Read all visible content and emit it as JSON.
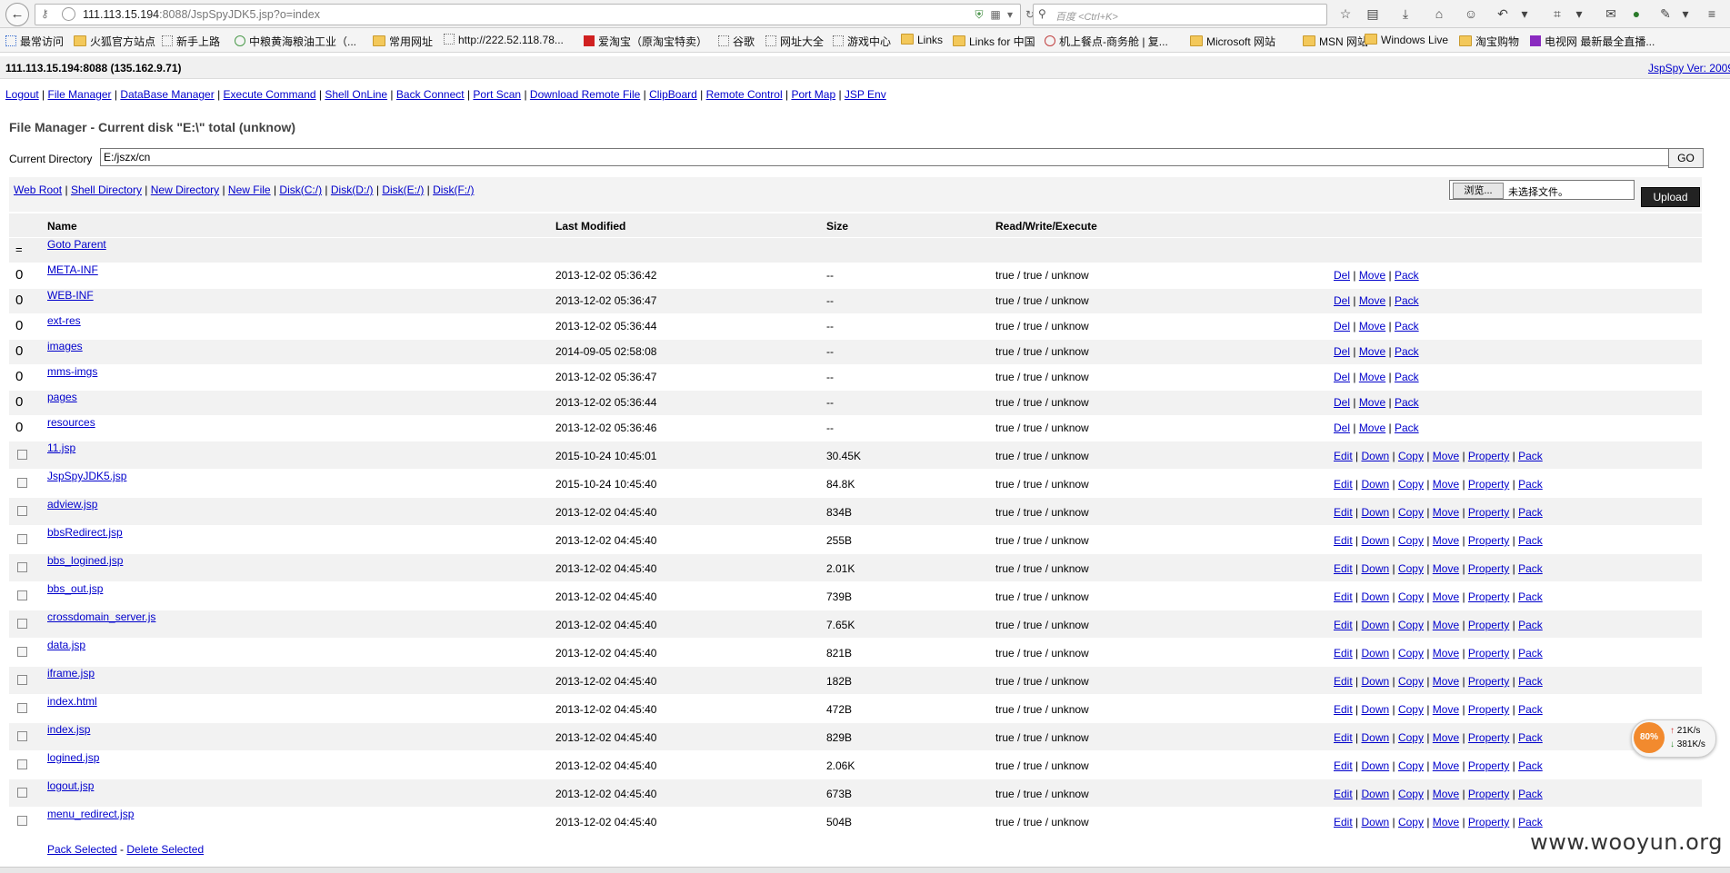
{
  "browser": {
    "url_host": "111.113.15.194",
    "url_path": ":8088/JspSpyJDK5.jsp?o=index",
    "search_placeholder": "百度 <Ctrl+K>"
  },
  "bookmarks": [
    "最常访问",
    "火狐官方站点",
    "新手上路",
    "中粮黄海粮油工业（...",
    "常用网址",
    "http://222.52.118.78...",
    "爱淘宝（原淘宝特卖）",
    "谷歌",
    "网址大全",
    "游戏中心",
    "Links",
    "Links for 中国",
    "机上餐点-商务舱 | 复...",
    "Microsoft 网站",
    "MSN 网站",
    "Windows Live",
    "淘宝购物",
    "电视网 最新最全直播..."
  ],
  "host": "111.113.15.194:8088 (135.162.9.71)",
  "version": "JspSpy Ver: 2009",
  "menu": [
    "Logout",
    "File Manager",
    "DataBase Manager",
    "Execute Command",
    "Shell OnLine",
    "Back Connect",
    "Port Scan",
    "Download Remote File",
    "ClipBoard",
    "Remote Control",
    "Port Map",
    "JSP Env"
  ],
  "title": "File Manager - Current disk \"E:\\\" total (unknow)",
  "current_dir": {
    "label": "Current Directory",
    "value": "E:/jszx/cn",
    "go": "GO"
  },
  "toolbar": [
    "Web Root",
    "Shell Directory",
    "New Directory",
    "New File",
    "Disk(C:/)",
    "Disk(D:/)",
    "Disk(E:/)",
    "Disk(F:/)"
  ],
  "upload": {
    "browse": "浏览...",
    "no_file": "未选择文件。",
    "button": "Upload"
  },
  "table": {
    "headers": [
      "Name",
      "Last Modified",
      "Size",
      "Read/Write/Execute"
    ],
    "parent": {
      "marker": "=",
      "label": "Goto Parent"
    },
    "dirs": [
      {
        "name": "META-INF",
        "modified": "2013-12-02 05:36:42",
        "size": "--",
        "rwx": "true / true / unknow"
      },
      {
        "name": "WEB-INF",
        "modified": "2013-12-02 05:36:47",
        "size": "--",
        "rwx": "true / true / unknow"
      },
      {
        "name": "ext-res",
        "modified": "2013-12-02 05:36:44",
        "size": "--",
        "rwx": "true / true / unknow"
      },
      {
        "name": "images",
        "modified": "2014-09-05 02:58:08",
        "size": "--",
        "rwx": "true / true / unknow"
      },
      {
        "name": "mms-imgs",
        "modified": "2013-12-02 05:36:47",
        "size": "--",
        "rwx": "true / true / unknow"
      },
      {
        "name": "pages",
        "modified": "2013-12-02 05:36:44",
        "size": "--",
        "rwx": "true / true / unknow"
      },
      {
        "name": "resources",
        "modified": "2013-12-02 05:36:46",
        "size": "--",
        "rwx": "true / true / unknow"
      }
    ],
    "dir_marker": "0",
    "dir_actions": [
      "Del",
      "Move",
      "Pack"
    ],
    "files": [
      {
        "name": "11.jsp",
        "modified": "2015-10-24 10:45:01",
        "size": "30.45K",
        "rwx": "true / true / unknow"
      },
      {
        "name": "JspSpyJDK5.jsp",
        "modified": "2015-10-24 10:45:40",
        "size": "84.8K",
        "rwx": "true / true / unknow"
      },
      {
        "name": "adview.jsp",
        "modified": "2013-12-02 04:45:40",
        "size": "834B",
        "rwx": "true / true / unknow"
      },
      {
        "name": "bbsRedirect.jsp",
        "modified": "2013-12-02 04:45:40",
        "size": "255B",
        "rwx": "true / true / unknow"
      },
      {
        "name": "bbs_logined.jsp",
        "modified": "2013-12-02 04:45:40",
        "size": "2.01K",
        "rwx": "true / true / unknow"
      },
      {
        "name": "bbs_out.jsp",
        "modified": "2013-12-02 04:45:40",
        "size": "739B",
        "rwx": "true / true / unknow"
      },
      {
        "name": "crossdomain_server.js",
        "modified": "2013-12-02 04:45:40",
        "size": "7.65K",
        "rwx": "true / true / unknow"
      },
      {
        "name": "data.jsp",
        "modified": "2013-12-02 04:45:40",
        "size": "821B",
        "rwx": "true / true / unknow"
      },
      {
        "name": "iframe.jsp",
        "modified": "2013-12-02 04:45:40",
        "size": "182B",
        "rwx": "true / true / unknow"
      },
      {
        "name": "index.html",
        "modified": "2013-12-02 04:45:40",
        "size": "472B",
        "rwx": "true / true / unknow"
      },
      {
        "name": "index.jsp",
        "modified": "2013-12-02 04:45:40",
        "size": "829B",
        "rwx": "true / true / unknow"
      },
      {
        "name": "logined.jsp",
        "modified": "2013-12-02 04:45:40",
        "size": "2.06K",
        "rwx": "true / true / unknow"
      },
      {
        "name": "logout.jsp",
        "modified": "2013-12-02 04:45:40",
        "size": "673B",
        "rwx": "true / true / unknow"
      },
      {
        "name": "menu_redirect.jsp",
        "modified": "2013-12-02 04:45:40",
        "size": "504B",
        "rwx": "true / true / unknow"
      }
    ],
    "file_actions": [
      "Edit",
      "Down",
      "Copy",
      "Move",
      "Property",
      "Pack"
    ]
  },
  "footer": {
    "pack": "Pack Selected",
    "sep": " - ",
    "delete": "Delete Selected"
  },
  "speed": {
    "percent": "80%",
    "up": "21K/s",
    "down": "381K/s"
  },
  "watermark": "www.wooyun.org"
}
